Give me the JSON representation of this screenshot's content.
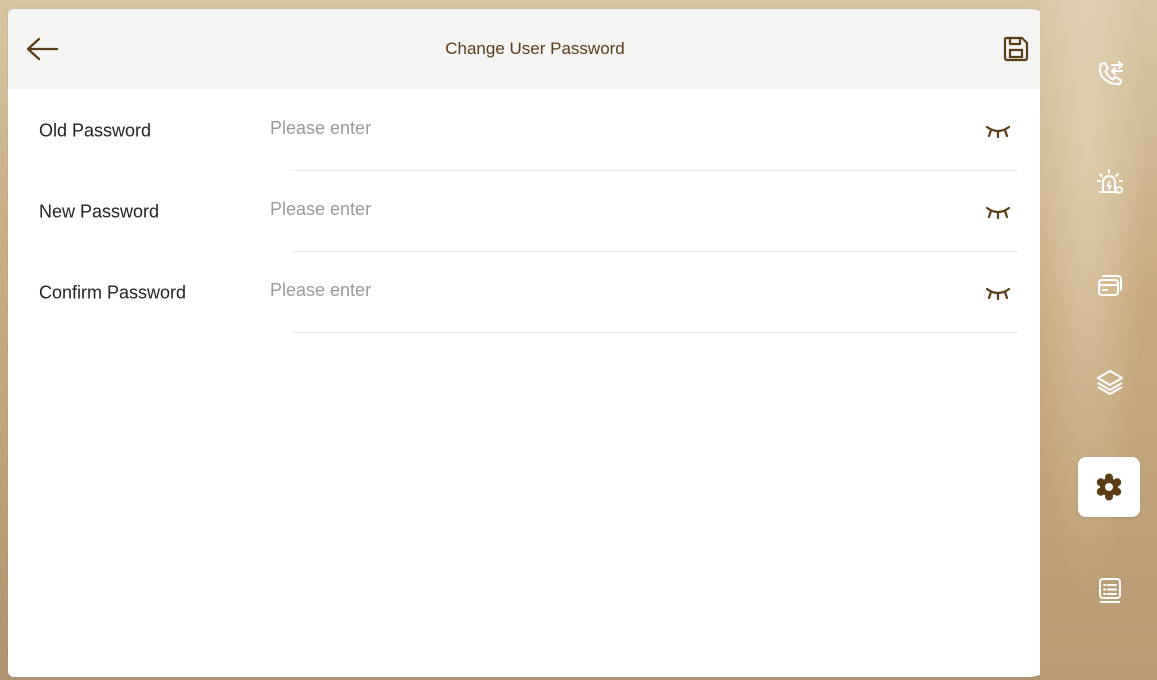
{
  "header": {
    "title": "Change User Password",
    "back_icon": "arrow-left-icon",
    "save_icon": "floppy-disk-icon"
  },
  "form": {
    "fields": [
      {
        "label": "Old Password",
        "placeholder": "Please enter",
        "value": "",
        "toggle_icon": "eye-closed-icon"
      },
      {
        "label": "New Password",
        "placeholder": "Please enter",
        "value": "",
        "toggle_icon": "eye-closed-icon"
      },
      {
        "label": "Confirm Password",
        "placeholder": "Please enter",
        "value": "",
        "toggle_icon": "eye-closed-icon"
      }
    ]
  },
  "sidebar": {
    "items": [
      {
        "icon": "call-transfer-icon",
        "active": false
      },
      {
        "icon": "alarm-icon",
        "active": false
      },
      {
        "icon": "cards-icon",
        "active": false
      },
      {
        "icon": "layers-icon",
        "active": false
      },
      {
        "icon": "settings-gear-icon",
        "active": true
      },
      {
        "icon": "list-icon",
        "active": false
      }
    ]
  },
  "colors": {
    "accent": "#5a3d16",
    "header_bg": "#f4f4f3",
    "rail_bg": "#c7ab80"
  }
}
